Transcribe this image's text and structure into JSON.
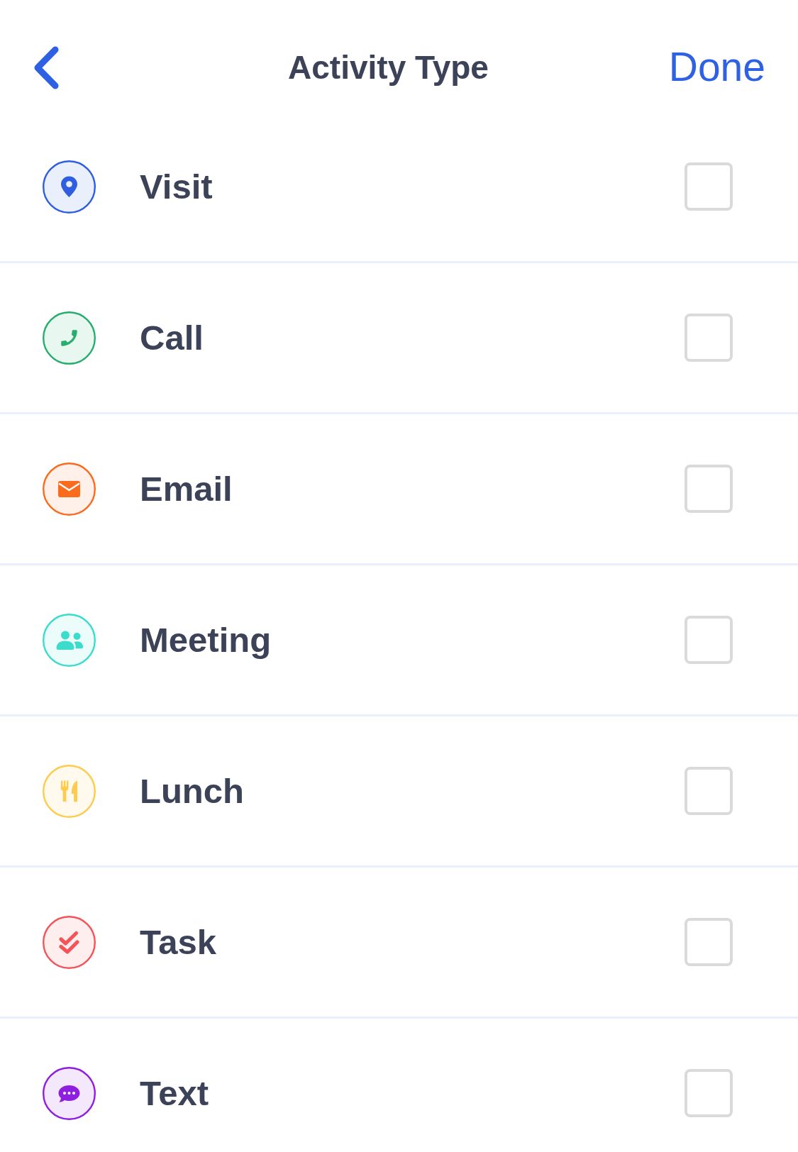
{
  "header": {
    "title": "Activity Type",
    "done": "Done"
  },
  "activities": [
    {
      "label": "Visit",
      "kind": "pin",
      "color": "#2f5fe0",
      "checked": false
    },
    {
      "label": "Call",
      "kind": "phone",
      "color": "#27ae6f",
      "checked": false
    },
    {
      "label": "Email",
      "kind": "envelope",
      "color": "#fb6b1e",
      "checked": false
    },
    {
      "label": "Meeting",
      "kind": "people",
      "color": "#3cdccd",
      "checked": false
    },
    {
      "label": "Lunch",
      "kind": "utensils",
      "color": "#fdcb4e",
      "checked": false
    },
    {
      "label": "Task",
      "kind": "doublecheck",
      "color": "#f45459",
      "checked": false
    },
    {
      "label": "Text",
      "kind": "chat",
      "color": "#8e1ee0",
      "checked": false
    }
  ]
}
